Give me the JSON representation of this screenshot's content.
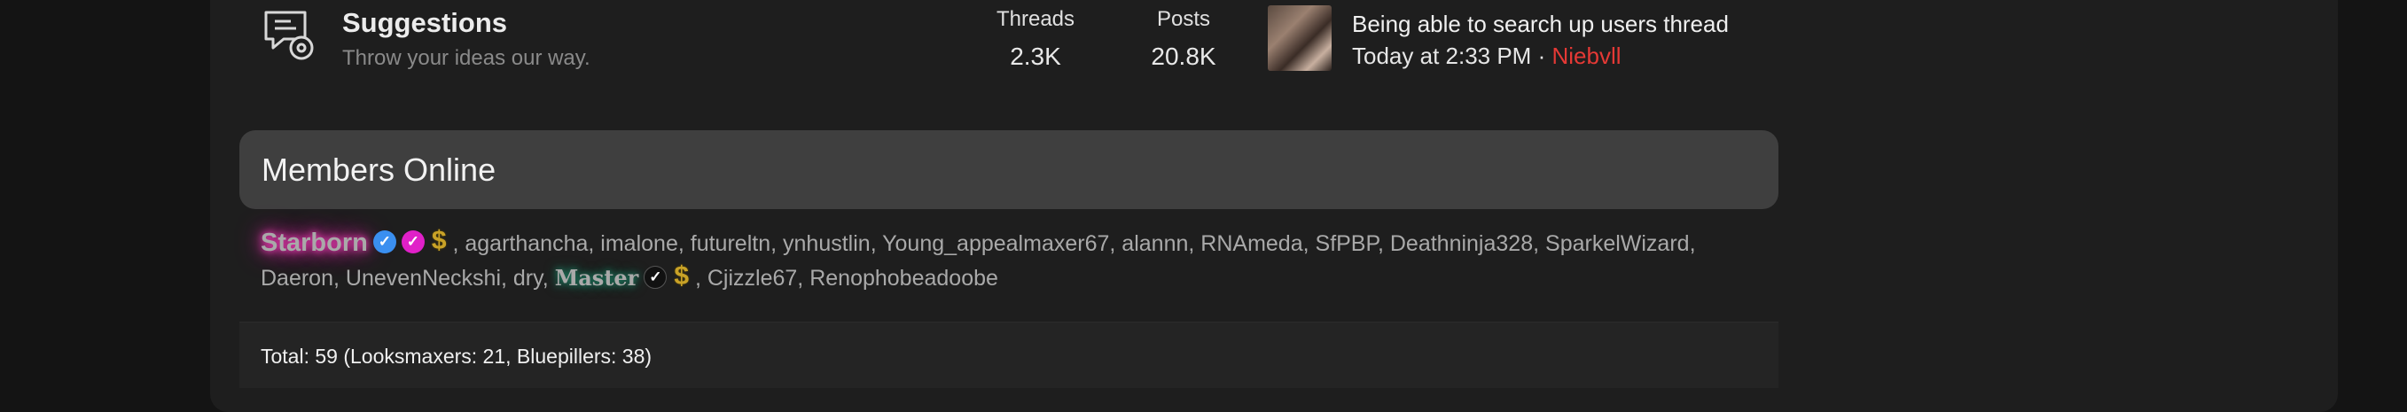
{
  "forum": {
    "title": "Suggestions",
    "description": "Throw your ideas our way.",
    "icon": "chat-gear-icon",
    "stats": [
      {
        "label": "Threads",
        "value": "2.3K"
      },
      {
        "label": "Posts",
        "value": "20.8K"
      }
    ],
    "latest": {
      "title": "Being able to search up users thread",
      "time": "Today at 2:33 PM",
      "separator": "·",
      "user": "Niebvll"
    }
  },
  "members_online": {
    "title": "Members Online",
    "members": [
      {
        "name": "Starborn"
      },
      {
        "name": "agarthancha"
      },
      {
        "name": "imalone"
      },
      {
        "name": "futureltn"
      },
      {
        "name": "ynhustlin"
      },
      {
        "name": "Young_appealmaxer67"
      },
      {
        "name": "alannn"
      },
      {
        "name": "RNAmeda"
      },
      {
        "name": "SfPBP"
      },
      {
        "name": "Deathninja328"
      },
      {
        "name": "SparkelWizard"
      },
      {
        "name": "Daeron"
      },
      {
        "name": "UnevenNeckshi"
      },
      {
        "name": "dry"
      },
      {
        "name": "Master"
      },
      {
        "name": "Cjizzle67"
      },
      {
        "name": "Renophobeadoobe"
      }
    ],
    "badges": {
      "verified": "check-badge-icon",
      "pink": "check-badge-pink-icon",
      "dark": "check-badge-dark-icon",
      "dollar": "dollar-icon",
      "dollar_glyph": "$",
      "check_glyph": "✓"
    },
    "total": "Total: 59 (Looksmaxers: 21, Bluepillers: 38)"
  },
  "colors": {
    "latest_user": "#e53935",
    "starborn_glow": "#ff3fbf",
    "link_blue": "#5b7fe8",
    "link_cyan": "#29b6e6",
    "verified_badge": "#3a8ff0",
    "pink_badge": "#e020c8",
    "dollar": "#c9a227"
  }
}
